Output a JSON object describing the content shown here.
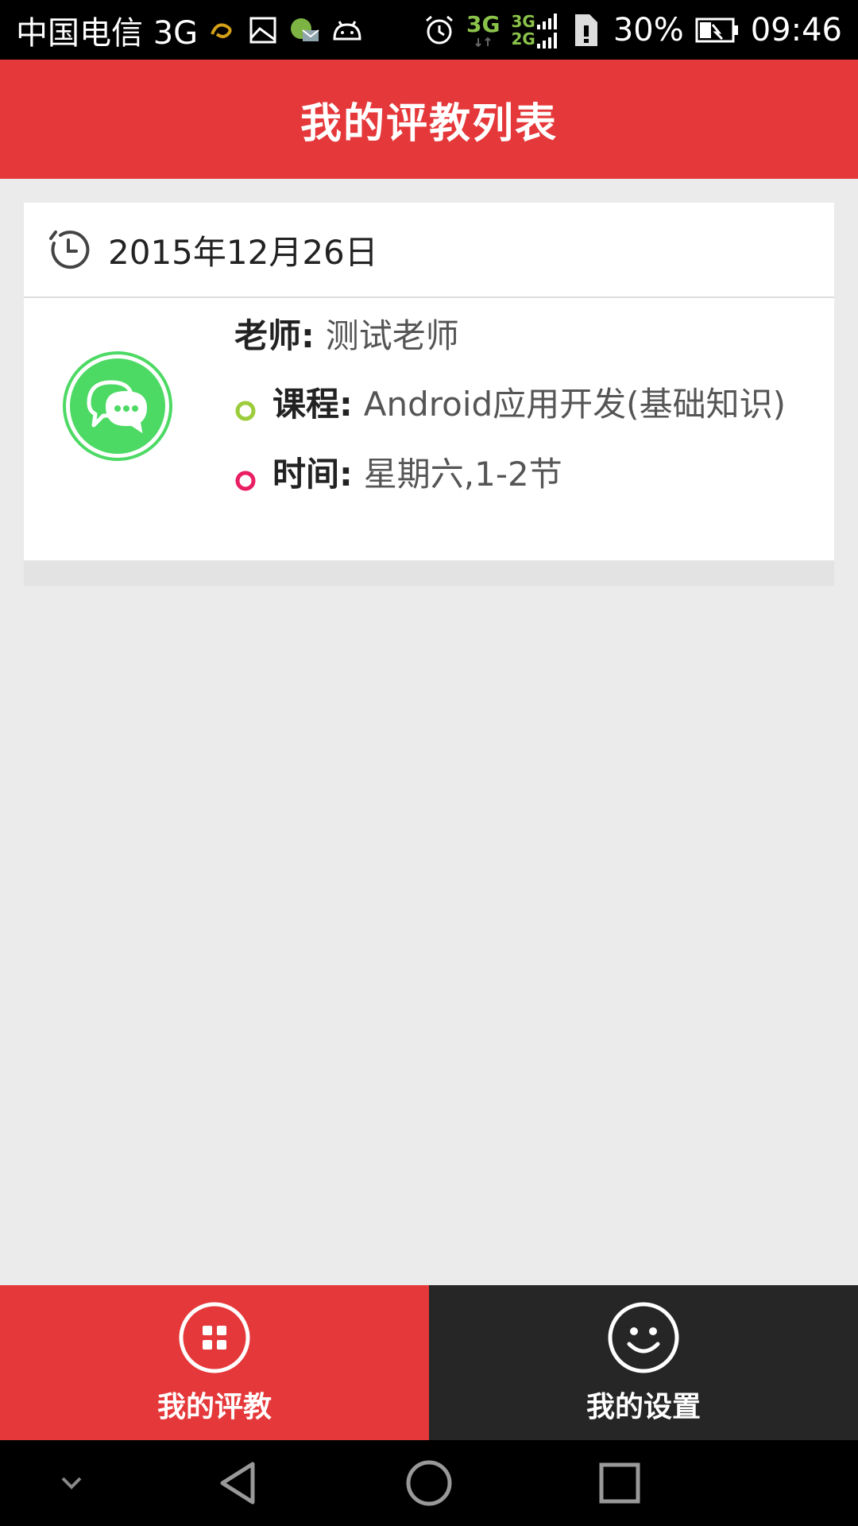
{
  "status_bar": {
    "carrier": "中国电信 3G",
    "signal_top": "3G",
    "signal_bottom": "2G",
    "network_label": "3G",
    "battery": "30%",
    "time": "09:46"
  },
  "header": {
    "title": "我的评教列表"
  },
  "evaluations": [
    {
      "date": "2015年12月26日",
      "teacher_label": "老师:",
      "teacher": "测试老师",
      "course_label": "课程:",
      "course": "Android应用开发(基础知识)",
      "time_label": "时间:",
      "time": "星期六,1-2节"
    }
  ],
  "tabs": [
    {
      "label": "我的评教",
      "icon": "grid-icon",
      "active": true
    },
    {
      "label": "我的设置",
      "icon": "smiley-icon",
      "active": false
    }
  ],
  "colors": {
    "accent": "#e5383a",
    "tab_inactive": "#262626",
    "avatar_green": "#4cd964",
    "bullet_green": "#9ccc3b",
    "bullet_pink": "#e91e63"
  },
  "nav": {
    "items": [
      "collapse-icon",
      "back-icon",
      "home-icon",
      "recents-icon"
    ]
  }
}
